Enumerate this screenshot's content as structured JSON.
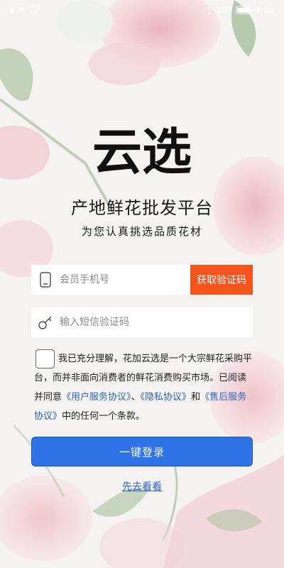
{
  "status_bar": {
    "net_speed": "27.2",
    "net_unit": "K/s",
    "battery": "100",
    "time": "4:16"
  },
  "brand": {
    "logo_text": "云选",
    "slogan": "产地鲜花批发平台",
    "tagline": "为您认真挑选品质花材"
  },
  "form": {
    "phone_placeholder": "会员手机号",
    "code_placeholder": "输入短信验证码",
    "get_code_label": "获取验证码"
  },
  "agreement": {
    "text_1": "我已充分理解，花加云选是一个大宗鲜花采购平台，而并非面向消费者的鲜花消费购买市场。已阅读并同意",
    "link_user": "《用户服务协议》",
    "sep_1": "、",
    "link_privacy": "《隐私协议》",
    "sep_2": "和",
    "link_aftersale": "《售后服务协议》",
    "text_2": "中的任何一个条款。"
  },
  "actions": {
    "login_label": "一键登录",
    "browse_label": "先去看看"
  }
}
